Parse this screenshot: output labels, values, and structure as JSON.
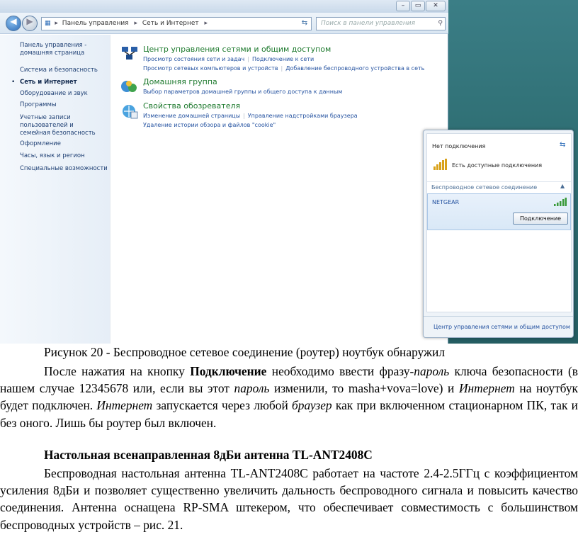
{
  "window": {
    "address_segments": [
      "Панель управления",
      "Сеть и Интернет"
    ],
    "search_placeholder": "Поиск в панели управления"
  },
  "sidebar": {
    "items": [
      {
        "label": "Панель управления - домашняя страница"
      },
      {
        "label": "Система и безопасность"
      },
      {
        "label": "Сеть и Интернет",
        "active": true
      },
      {
        "label": "Оборудование и звук"
      },
      {
        "label": "Программы"
      },
      {
        "label": "Учетные записи пользователей и семейная безопасность"
      },
      {
        "label": "Оформление"
      },
      {
        "label": "Часы, язык и регион"
      },
      {
        "label": "Специальные возможности"
      }
    ]
  },
  "categories": [
    {
      "title": "Центр управления сетями и общим доступом",
      "icon": "network-center-icon",
      "links": [
        [
          "Просмотр состояния сети и задач",
          "Подключение к сети"
        ],
        [
          "Просмотр сетевых компьютеров и устройств",
          "Добавление беспроводного устройства в сеть"
        ]
      ]
    },
    {
      "title": "Домашняя группа",
      "icon": "homegroup-icon",
      "links": [
        [
          "Выбор параметров домашней группы и общего доступа к данным"
        ]
      ]
    },
    {
      "title": "Свойства обозревателя",
      "icon": "browser-properties-icon",
      "links": [
        [
          "Изменение домашней страницы",
          "Управление надстройками браузера"
        ],
        [
          "Удаление истории обзора и файлов \"cookie\""
        ]
      ]
    }
  ],
  "popup": {
    "status": "Нет подключения",
    "available": "Есть доступные подключения",
    "section": "Беспроводное сетевое соединение",
    "network_name": "NETGEAR",
    "connect_button": "Подключение",
    "footer_link": "Центр управления сетями и общим доступом"
  },
  "document": {
    "caption": "Рисунок 20 -  Беспроводное сетевое соединение (роутер) ноутбук обнаружил",
    "p1": [
      {
        "t": "После нажатия на кнопку "
      },
      {
        "t": "Подключение",
        "s": "b"
      },
      {
        "t": " необходимо ввести фразу-"
      },
      {
        "t": "пароль",
        "s": "i"
      },
      {
        "t": " ключа безопасности (в нашем случае 12345678 или, если вы этот "
      },
      {
        "t": "пароль",
        "s": "i"
      },
      {
        "t": " изменили, то masha+vova=love) и "
      },
      {
        "t": "Интернет",
        "s": "i"
      },
      {
        "t": " на ноутбук будет подключен. "
      },
      {
        "t": "Интернет",
        "s": "i"
      },
      {
        "t": " запускается через любой "
      },
      {
        "t": "браузер",
        "s": "i"
      },
      {
        "t": " как при включенном стационарном ПК, так и без оного. Лишь бы роутер был включен."
      }
    ],
    "heading": "Настольная всенаправленная 8дБи антенна TL-ANT2408C",
    "p2": "Беспроводная настольная антенна TL-ANT2408C работает на частоте 2.4-2.5ГГц с коэффициентом усиления 8дБи и позволяет существенно увеличить дальность беспроводного сигнала и повысить качество соединения. Антенна оснащена RP-SMA штекером, что обеспечивает совместимость с большинством беспроводных устройств – рис. 21."
  }
}
